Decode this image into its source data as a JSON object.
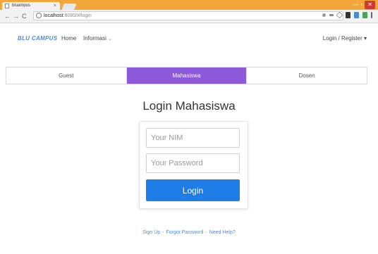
{
  "browser": {
    "tab_title": "bluampus",
    "tab_close": "×",
    "url_host": "localhost",
    "url_path": ":8080/#/login",
    "nav_back": "←",
    "nav_forward": "→",
    "nav_reload": "C",
    "window_min": "—",
    "window_max": "▫",
    "window_close": "✕"
  },
  "navbar": {
    "brand": "BLU CAMPUS",
    "home": "Home",
    "informasi": "Informasi",
    "informasi_caret": "⌄",
    "login_register": "Login / Register ▾"
  },
  "role_tabs": [
    {
      "label": "Guest",
      "active": false
    },
    {
      "label": "Mahasiswa",
      "active": true
    },
    {
      "label": "Dosen",
      "active": false
    }
  ],
  "login": {
    "title": "Login Mahasiswa",
    "nim_placeholder": "Your NIM",
    "password_placeholder": "Your Password",
    "button": "Login"
  },
  "footer": {
    "signup": "Sign Up",
    "forgot": "Forgot Password",
    "help": "Need Help?",
    "separator": "-"
  },
  "colors": {
    "accent_purple": "#8b59d9",
    "button_blue": "#1e7de6",
    "link_blue": "#4a8be0",
    "chrome_orange": "#f3a63a"
  }
}
